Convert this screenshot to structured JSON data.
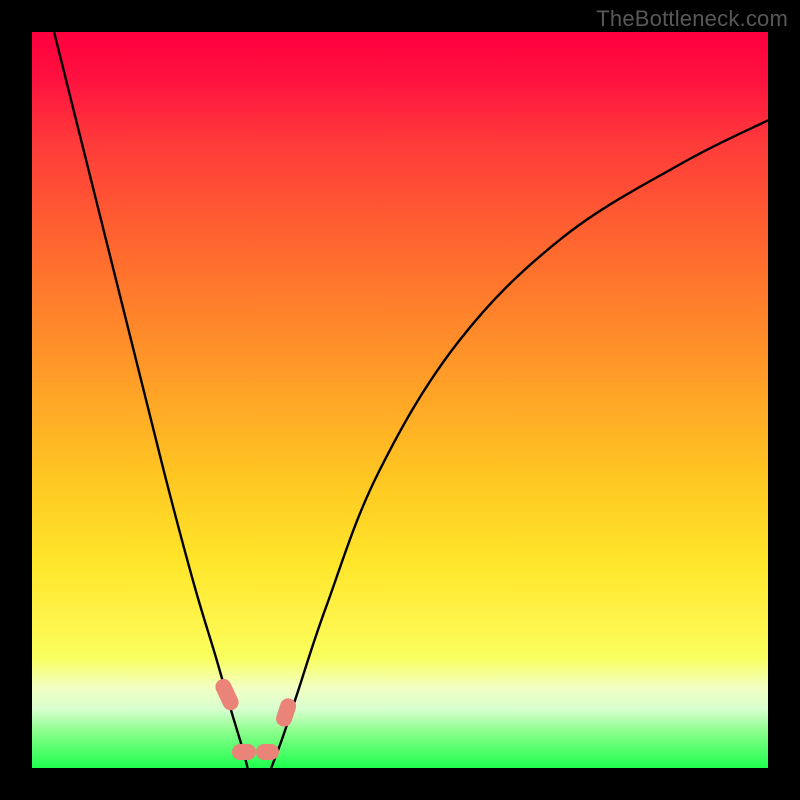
{
  "watermark": "TheBottleneck.com",
  "chart_data": {
    "type": "line",
    "title": "",
    "xlabel": "",
    "ylabel": "",
    "ylim": [
      0,
      100
    ],
    "xlim": [
      0,
      100
    ],
    "series": [
      {
        "name": "left-curve",
        "x": [
          3,
          8,
          13,
          18,
          22,
          25,
          27,
          28.5,
          29.3
        ],
        "y": [
          100,
          80,
          60,
          40,
          25,
          15,
          8,
          3,
          0
        ]
      },
      {
        "name": "right-curve",
        "x": [
          32.5,
          34,
          36,
          40,
          47,
          58,
          72,
          88,
          100
        ],
        "y": [
          0,
          4,
          10,
          22,
          40,
          58,
          72,
          82,
          88
        ]
      }
    ],
    "ideal_zone_markers": [
      {
        "x": 26.5,
        "y": 10,
        "w": 2.2,
        "h": 4.5,
        "rot": -25
      },
      {
        "x": 28.8,
        "y": 2.2,
        "w": 3.2,
        "h": 2.2,
        "rot": 0
      },
      {
        "x": 32.0,
        "y": 2.2,
        "w": 3.2,
        "h": 2.2,
        "rot": 0
      },
      {
        "x": 34.5,
        "y": 7.5,
        "w": 2.2,
        "h": 4.0,
        "rot": 18
      }
    ]
  },
  "colors": {
    "curve": "#000000",
    "marker": "#ea8378",
    "background": "#000000"
  }
}
